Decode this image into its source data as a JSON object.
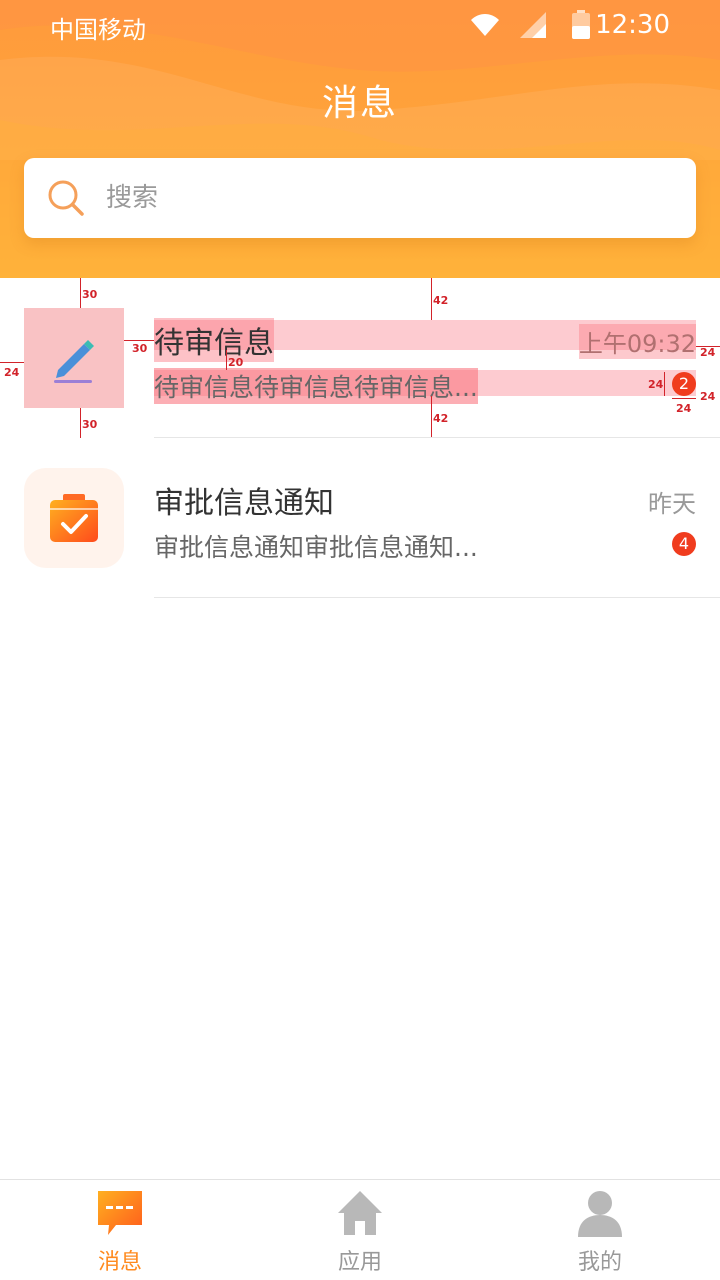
{
  "status_bar": {
    "carrier": "中国移动",
    "time": "12:30"
  },
  "header": {
    "title": "消息"
  },
  "search": {
    "placeholder": "搜索"
  },
  "messages": [
    {
      "title": "待审信息",
      "time": "上午09:32",
      "preview": "待审信息待审信息待审信息...",
      "badge": "2",
      "icon": "pencil-icon"
    },
    {
      "title": "审批信息通知",
      "time": "昨天",
      "preview": "审批信息通知审批信息通知...",
      "badge": "4",
      "icon": "calendar-check-icon"
    }
  ],
  "annotations": [
    "30",
    "42",
    "30",
    "20",
    "24",
    "24",
    "24",
    "24",
    "30",
    "42"
  ],
  "tabs": [
    {
      "label": "消息",
      "icon": "chat-icon",
      "active": true
    },
    {
      "label": "应用",
      "icon": "home-icon",
      "active": false
    },
    {
      "label": "我的",
      "icon": "user-icon",
      "active": false
    }
  ],
  "colors": {
    "accent": "#ff8a1e",
    "header_top": "#ff9a3c",
    "badge": "#f03c1e"
  }
}
